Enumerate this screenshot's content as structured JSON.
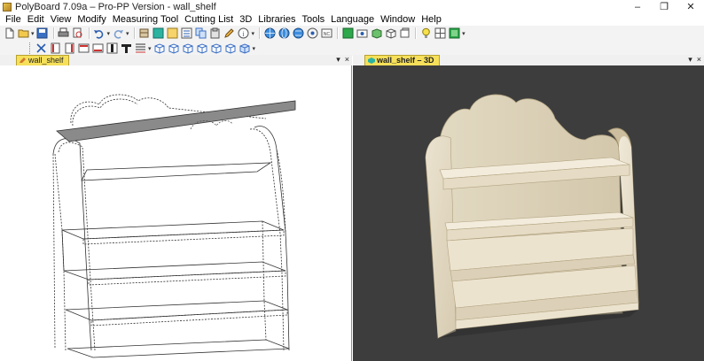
{
  "window": {
    "title": "PolyBoard 7.09a – Pro-PP Version - wall_shelf",
    "minimize": "–",
    "restore": "❐",
    "close": "✕"
  },
  "menu": [
    "File",
    "Edit",
    "View",
    "Modify",
    "Measuring Tool",
    "Cutting List",
    "3D",
    "Libraries",
    "Tools",
    "Language",
    "Window",
    "Help"
  ],
  "toolbar1_icons": [
    "new-file-icon",
    "open-file-icon",
    "save-icon",
    "print-icon",
    "print-preview-icon",
    "undo-icon",
    "redo-icon",
    "cabinet-icon",
    "color-swatch-icon",
    "material-icon",
    "list-icon",
    "copy-icon",
    "paste-icon",
    "pencil-icon",
    "info-icon",
    "world-icon",
    "globe-icon",
    "globe-alt-icon",
    "label-icon",
    "export-icon",
    "green-box-icon",
    "camera-icon",
    "green-cube-icon",
    "cube-icon",
    "box-icon",
    "lightbulb-icon",
    "grid-icon",
    "active-view-icon"
  ],
  "toolbar2_icons": [
    "cross-icon",
    "panel-front-icon",
    "panel-back-icon",
    "panel-left-icon",
    "panel-right-icon",
    "panel-center-icon",
    "tee-icon",
    "lines-icon",
    "view-cube-1-icon",
    "view-cube-2-icon",
    "view-cube-3-icon",
    "view-cube-4-icon",
    "view-cube-5-icon",
    "view-cube-6-icon",
    "view-cube-7-icon"
  ],
  "tabs": {
    "left": {
      "label": "wall_shelf",
      "menu": "▾",
      "close": "×"
    },
    "right": {
      "label": "wall_shelf – 3D",
      "menu": "▾",
      "close": "×"
    }
  },
  "colors": {
    "viewport_3d_bg": "#3d3d3d",
    "tab_active": "#f6e05a",
    "wood": "#e9e0cd"
  }
}
